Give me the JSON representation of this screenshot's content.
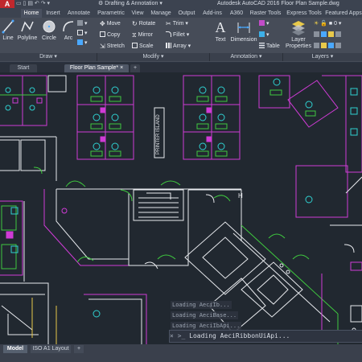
{
  "titlebar": {
    "logo": "A",
    "workspace": "Drafting & Annotation",
    "title": "Autodesk AutoCAD 2016    Floor Plan Sample.dwg"
  },
  "ribbon_tabs": [
    "Home",
    "Insert",
    "Annotate",
    "Parametric",
    "View",
    "Manage",
    "Output",
    "Add-ins",
    "A360",
    "Raster Tools",
    "Express Tools",
    "Featured Apps"
  ],
  "draw": {
    "line": "Line",
    "polyline": "Polyline",
    "circle": "Circle",
    "arc": "Arc",
    "panel": "Draw"
  },
  "modify": {
    "move": "Move",
    "rotate": "Rotate",
    "trim": "Trim",
    "copy": "Copy",
    "mirror": "Mirror",
    "fillet": "Fillet",
    "stretch": "Stretch",
    "scale": "Scale",
    "array": "Array",
    "panel": "Modify"
  },
  "annotation": {
    "text": "Text",
    "dimension": "Dimension",
    "table": "Table",
    "panel": "Annotation"
  },
  "layers": {
    "properties": "Layer Properties",
    "panel": "Layers"
  },
  "doc_tabs": {
    "start": "Start",
    "current": "Floor Plan Sample*",
    "add": "+"
  },
  "drawing": {
    "island_label": "PRINTER ISLAND"
  },
  "command": {
    "history": [
      "Loading AeciIb...",
      "Loading AeciBase...",
      "Loading AeciIbApi..."
    ],
    "current": "Loading AeciRibbonUiApi..."
  },
  "layout_tabs": {
    "model": "Model",
    "iso": "ISO A1 Layout",
    "add": "+"
  },
  "colors": {
    "accent": "#c0282d",
    "magenta": "#d03bd6",
    "green": "#3fc93f",
    "cyan": "#2fd0d0",
    "white_lines": "#e8eaee",
    "canvas": "#212830"
  }
}
